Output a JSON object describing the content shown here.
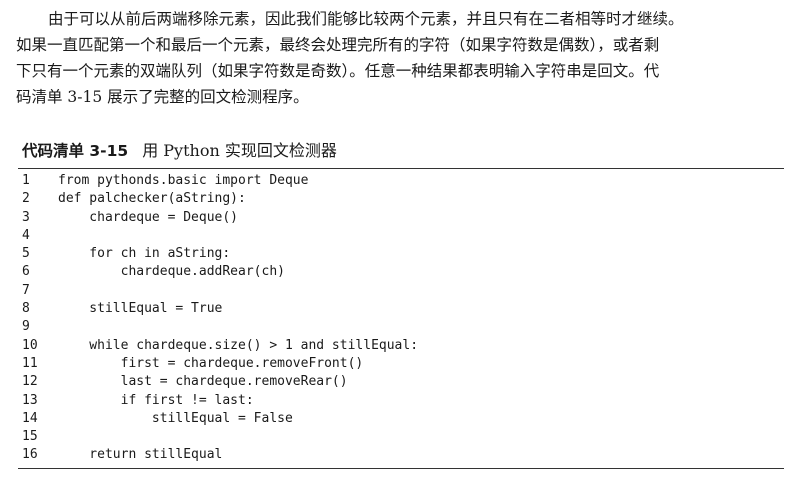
{
  "paragraph": {
    "lines": [
      "由于可以从前后两端移除元素，因此我们能够比较两个元素，并且只有在二者相等时才继续。",
      "如果一直匹配第一个和最后一个元素，最终会处理完所有的字符（如果字符数是偶数），或者剩",
      "下只有一个元素的双端队列（如果字符数是奇数）。任意一种结果都表明输入字符串是回文。代",
      "码清单 3-15 展示了完整的回文检测程序。"
    ]
  },
  "listing": {
    "label": "代码清单 3-15",
    "title": "用 Python 实现回文检测器",
    "lines": [
      {
        "num": "1",
        "code": "from pythonds.basic import Deque"
      },
      {
        "num": "2",
        "code": "def palchecker(aString):"
      },
      {
        "num": "3",
        "code": "    chardeque = Deque()"
      },
      {
        "num": "4",
        "code": ""
      },
      {
        "num": "5",
        "code": "    for ch in aString:"
      },
      {
        "num": "6",
        "code": "        chardeque.addRear(ch)"
      },
      {
        "num": "7",
        "code": ""
      },
      {
        "num": "8",
        "code": "    stillEqual = True"
      },
      {
        "num": "9",
        "code": ""
      },
      {
        "num": "10",
        "code": "    while chardeque.size() > 1 and stillEqual:"
      },
      {
        "num": "11",
        "code": "        first = chardeque.removeFront()"
      },
      {
        "num": "12",
        "code": "        last = chardeque.removeRear()"
      },
      {
        "num": "13",
        "code": "        if first != last:"
      },
      {
        "num": "14",
        "code": "            stillEqual = False"
      },
      {
        "num": "15",
        "code": ""
      },
      {
        "num": "16",
        "code": "    return stillEqual"
      }
    ]
  }
}
